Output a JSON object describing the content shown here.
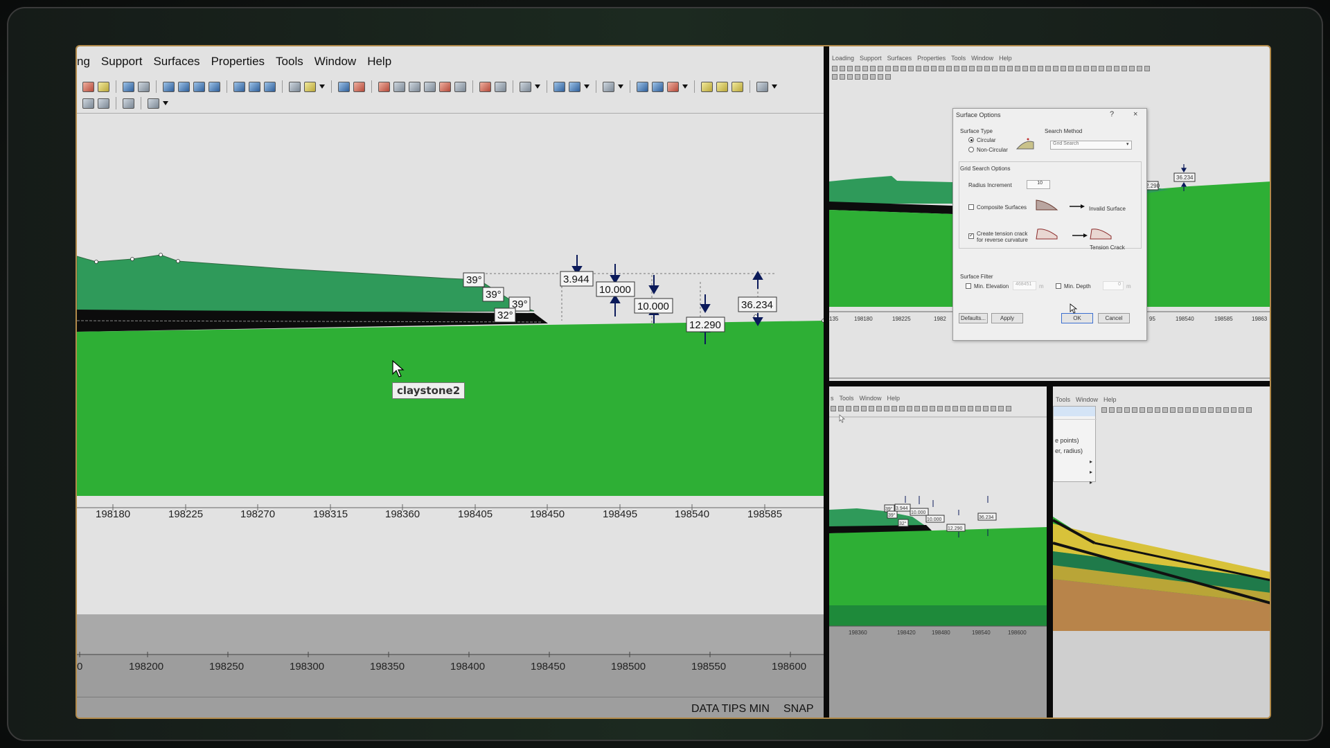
{
  "main": {
    "menu": [
      "ng",
      "Support",
      "Surfaces",
      "Properties",
      "Tools",
      "Window",
      "Help"
    ],
    "x_axis_ticks": [
      "198180",
      "198225",
      "198270",
      "198315",
      "198360",
      "198405",
      "198450",
      "198495",
      "198540",
      "198585"
    ],
    "lower_axis_ticks": [
      "0",
      "198200",
      "198250",
      "198300",
      "198350",
      "198400",
      "198450",
      "198500",
      "198550",
      "198600"
    ],
    "angles": [
      "39°",
      "39°",
      "39°",
      "32°"
    ],
    "dimensions": [
      "3.944",
      "10.000",
      "10.000",
      "12.290",
      "36.234"
    ],
    "tooltip": "claystone2",
    "status": {
      "data_tips": "DATA TIPS MIN",
      "snap": "SNAP"
    },
    "colors": {
      "upper_layer": "#2f9a5a",
      "lower_layer": "#2eaf35",
      "background": "#e2e2e2"
    }
  },
  "right_top": {
    "menu": [
      "Loading",
      "Support",
      "Surfaces",
      "Properties",
      "Tools",
      "Window",
      "Help"
    ],
    "axis_ticks": [
      "135",
      "198180",
      "198225",
      "1982",
      "95",
      "198540",
      "198585",
      "19863"
    ],
    "dims": [
      "36.234",
      "2.290"
    ],
    "dialog": {
      "title": "Surface Options",
      "help": "?",
      "close": "×",
      "surface_type_label": "Surface Type",
      "circular": "Circular",
      "non_circular": "Non-Circular",
      "search_method_label": "Search Method",
      "search_method_value": "Grid Search",
      "grid_options_label": "Grid Search Options",
      "radius_increment_label": "Radius Increment",
      "radius_increment_value": "10",
      "composite_label": "Composite Surfaces",
      "invalid_surface": "Invalid Surface",
      "tension_crack_label_1": "Create tension crack",
      "tension_crack_label_2": "for reverse curvature",
      "tension_crack": "Tension Crack",
      "surface_filter_label": "Surface Filter",
      "min_elevation": "Min. Elevation",
      "min_elevation_value": "468451",
      "min_depth": "Min. Depth",
      "min_depth_value": "0",
      "unit_m": "m",
      "defaults": "Defaults...",
      "apply": "Apply",
      "ok": "OK",
      "cancel": "Cancel"
    }
  },
  "right_bottom_left": {
    "menu": [
      "s",
      "Tools",
      "Window",
      "Help"
    ],
    "dims": [
      "39°",
      "3.944",
      "10.000",
      "39°",
      "10.000",
      "32°",
      "12.290",
      "36.234"
    ],
    "axis_ticks": [
      "198360",
      "198420",
      "198480",
      "198540",
      "198600"
    ]
  },
  "right_bottom_right": {
    "menu": [
      "Tools",
      "Window",
      "Help"
    ],
    "menu_items": [
      "e points)",
      "er, radius)"
    ]
  }
}
